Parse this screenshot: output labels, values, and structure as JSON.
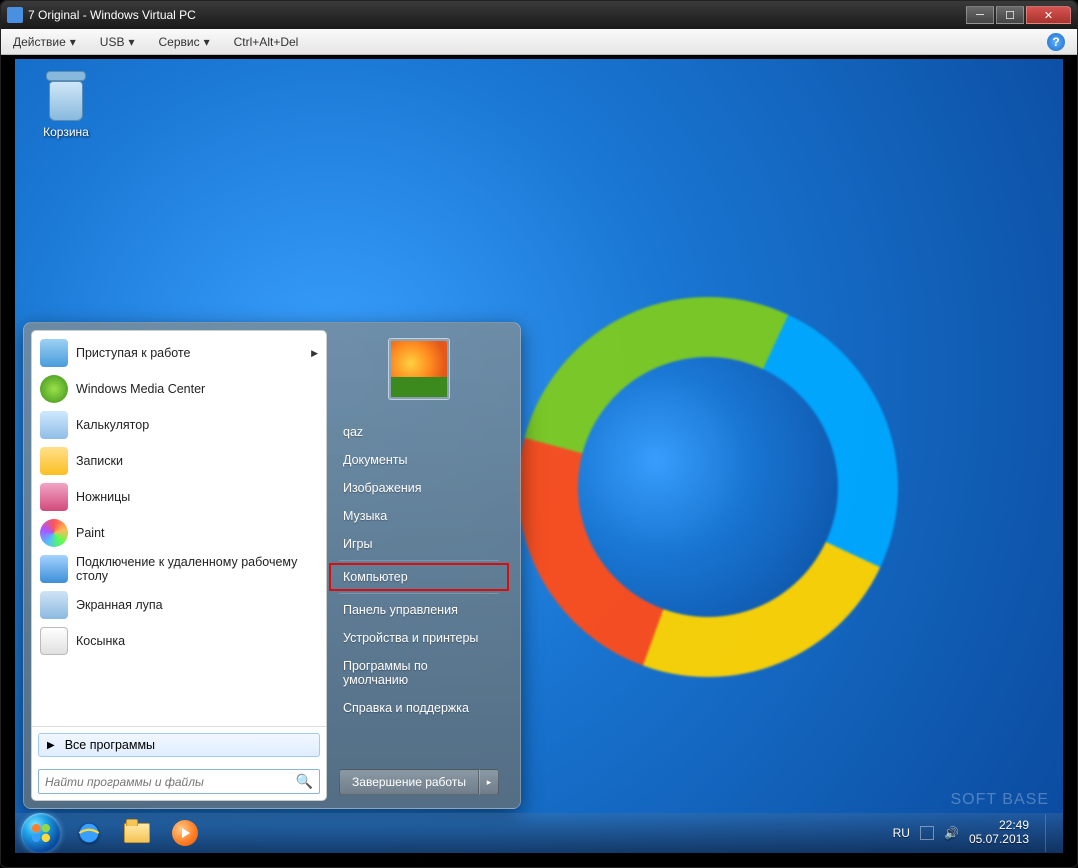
{
  "window": {
    "title": "7 Original - Windows Virtual PC"
  },
  "vm_menu": {
    "action": "Действие",
    "usb": "USB",
    "service": "Сервис",
    "cad": "Ctrl+Alt+Del"
  },
  "desktop": {
    "recycle_bin": "Корзина"
  },
  "start_menu": {
    "programs": [
      "Приступая к работе",
      "Windows Media Center",
      "Калькулятор",
      "Записки",
      "Ножницы",
      "Paint",
      "Подключение к удаленному рабочему столу",
      "Экранная лупа",
      "Косынка"
    ],
    "all_programs": "Все программы",
    "search_placeholder": "Найти программы и файлы",
    "right": {
      "user": "qaz",
      "docs": "Документы",
      "pics": "Изображения",
      "music": "Музыка",
      "games": "Игры",
      "computer": "Компьютер",
      "cpanel": "Панель управления",
      "devices": "Устройства и принтеры",
      "defaults": "Программы по умолчанию",
      "help": "Справка и поддержка"
    },
    "shutdown": "Завершение работы"
  },
  "tray": {
    "lang": "RU",
    "time": "22:49",
    "date": "05.07.2013"
  },
  "watermark": "SOFT BASE"
}
